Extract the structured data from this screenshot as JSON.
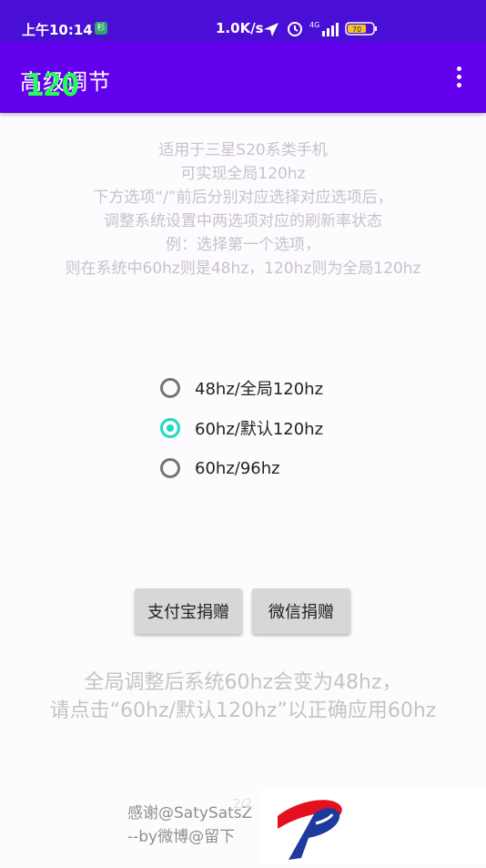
{
  "status_bar": {
    "time": "上午10:14",
    "network_speed": "1.0K/s",
    "network_type": "4G",
    "battery": "70"
  },
  "app_bar": {
    "title": "高级调节",
    "fps_overlay": "120",
    "menu_icon": "more-vert-icon"
  },
  "intro": {
    "lines": [
      "适用于三星S20系类手机",
      "可实现全局120hz",
      "下方选项“/”前后分别对应选择对应选项后，",
      "调整系统设置中两选项对应的刷新率状态",
      "例：选择第一个选项，",
      "则在系统中60hz则是48hz，120hz则为全局120hz"
    ]
  },
  "radio_group": {
    "options": [
      {
        "label": "48hz/全局120hz",
        "checked": false
      },
      {
        "label": "60hz/默认120hz",
        "checked": true
      },
      {
        "label": "60hz/96hz",
        "checked": false
      }
    ],
    "accent_color": "#1ed8c2"
  },
  "buttons": {
    "alipay": "支付宝捐赠",
    "wechat": "微信捐赠"
  },
  "notice": {
    "line1": "全局调整后系统60hz会变为48hz，",
    "line2": "请点击“60hz/默认120hz”以正确应用60hz"
  },
  "footer": {
    "line1": "感谢@SatySatsZ",
    "line2": "--by微博@留下",
    "pager": "2/2"
  },
  "colors": {
    "status_bar": "#4a0fd6",
    "app_bar": "#6200ee"
  }
}
